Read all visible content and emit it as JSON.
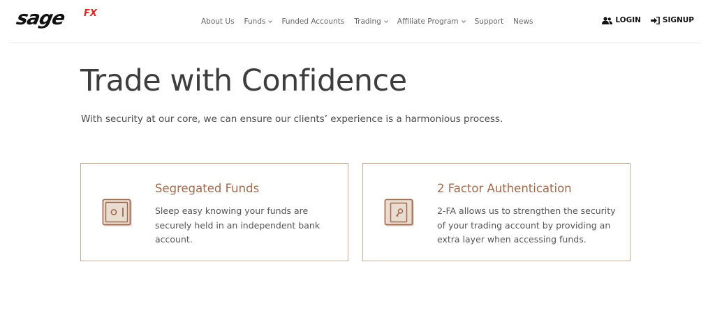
{
  "logo": {
    "main": "sage",
    "suffix": "FX"
  },
  "nav": {
    "items": [
      {
        "label": "About Us",
        "dropdown": false
      },
      {
        "label": "Funds",
        "dropdown": true
      },
      {
        "label": "Funded Accounts",
        "dropdown": false
      },
      {
        "label": "Trading",
        "dropdown": true
      },
      {
        "label": "Affiliate Program",
        "dropdown": true
      },
      {
        "label": "Support",
        "dropdown": false
      },
      {
        "label": "News",
        "dropdown": false
      }
    ]
  },
  "auth": {
    "login_label": "LOGIN",
    "signup_label": "SIGNUP"
  },
  "hero": {
    "title": "Trade with Confidence",
    "subtitle": "With security at our core, we can ensure our clients’ experience is a harmonious process."
  },
  "cards": [
    {
      "icon": "safe-icon",
      "title": "Segregated Funds",
      "text": "Sleep easy knowing your funds are securely held in an independent bank account."
    },
    {
      "icon": "secure-door-icon",
      "title": "2 Factor Authentication",
      "text": "2-FA allows us to strengthen the security of your trading account by providing an extra layer when accessing funds."
    }
  ],
  "colors": {
    "accent": "#9d6a4d",
    "card_border": "#c8ad97",
    "logo_fx": "#d9281e",
    "icon_fill": "#ebdcd2"
  }
}
